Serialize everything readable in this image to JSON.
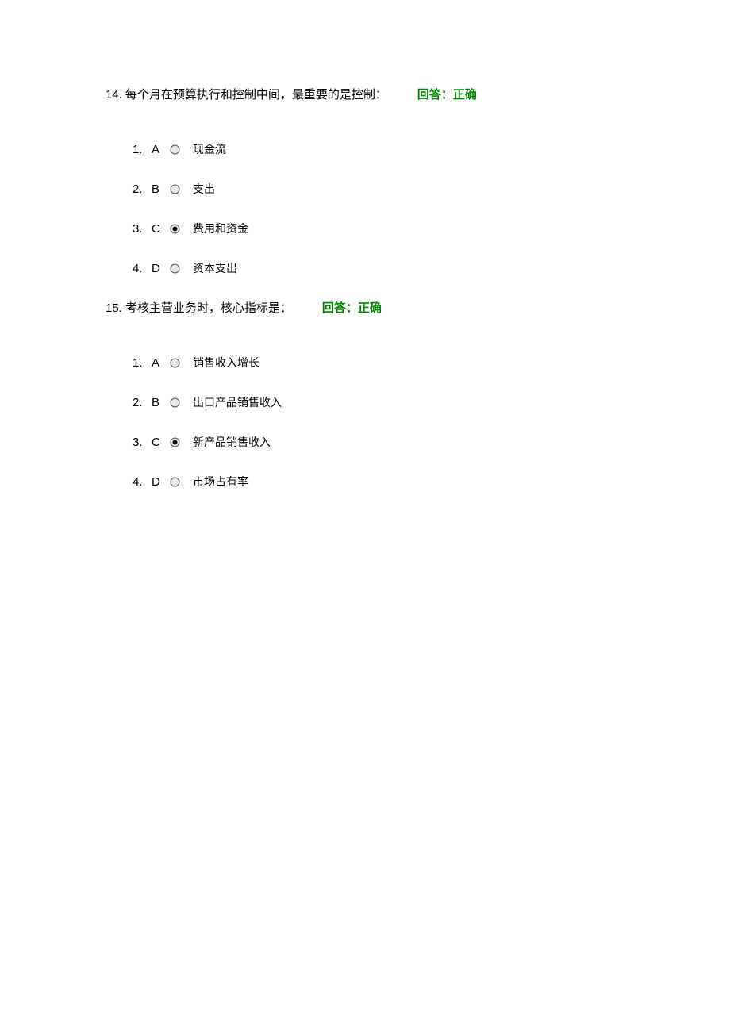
{
  "questions": [
    {
      "number": "14.",
      "text": "每个月在预算执行和控制中间，最重要的是控制：",
      "feedback": "回答：正确",
      "options": [
        {
          "num": "1.",
          "letter": "A",
          "text": "现金流",
          "selected": false
        },
        {
          "num": "2.",
          "letter": "B",
          "text": "支出",
          "selected": false
        },
        {
          "num": "3.",
          "letter": "C",
          "text": "费用和资金",
          "selected": true
        },
        {
          "num": "4.",
          "letter": "D",
          "text": "资本支出",
          "selected": false
        }
      ]
    },
    {
      "number": "15.",
      "text": "考核主营业务时，核心指标是：",
      "feedback": "回答：正确",
      "options": [
        {
          "num": "1.",
          "letter": "A",
          "text": "销售收入增长",
          "selected": false
        },
        {
          "num": "2.",
          "letter": "B",
          "text": "出口产品销售收入",
          "selected": false
        },
        {
          "num": "3.",
          "letter": "C",
          "text": "新产品销售收入",
          "selected": true
        },
        {
          "num": "4.",
          "letter": "D",
          "text": "市场占有率",
          "selected": false
        }
      ]
    }
  ]
}
